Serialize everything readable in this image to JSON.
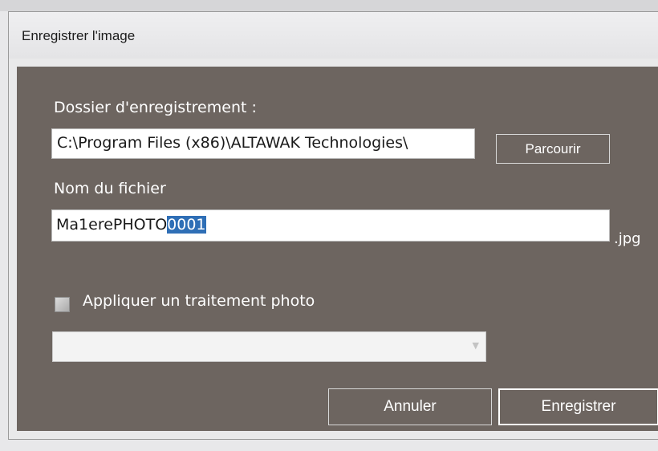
{
  "window": {
    "title": "Enregistrer l'image"
  },
  "folder": {
    "label": "Dossier d'enregistrement :",
    "value": "C:\\Program Files (x86)\\ALTAWAK Technologies\\",
    "browse_label": "Parcourir"
  },
  "filename": {
    "label": "Nom du fichier",
    "value_prefix": "Ma1erePHOTO",
    "value_selected": "0001",
    "extension": ".jpg"
  },
  "processing": {
    "checkbox_label": "Appliquer un traitement photo",
    "checked": false,
    "select_value": ""
  },
  "actions": {
    "cancel_label": "Annuler",
    "save_label": "Enregistrer"
  },
  "colors": {
    "panel": "#6d6560",
    "selection": "#2f6fb6"
  }
}
